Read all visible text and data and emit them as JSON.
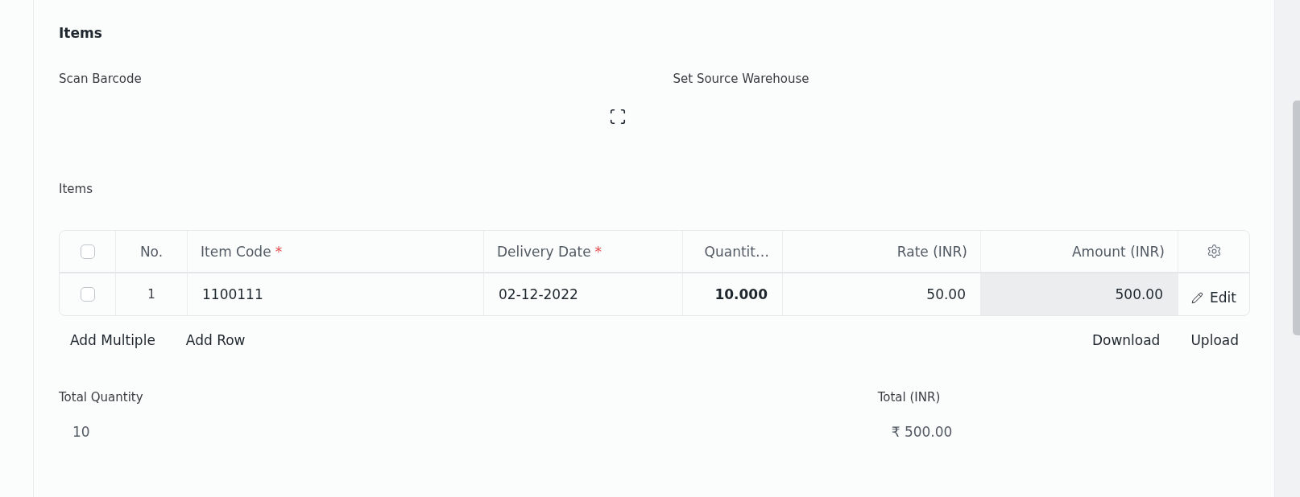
{
  "section": {
    "title": "Items"
  },
  "fields": [
    {
      "label": "Scan Barcode",
      "kind": "scan"
    },
    {
      "label": "Set Source Warehouse",
      "kind": "plain"
    }
  ],
  "table_label": "Items",
  "table": {
    "select_all": {
      "checked": false
    },
    "columns": [
      {
        "label": "No.",
        "kind": "index"
      },
      {
        "label": "Item Code",
        "mark": "*",
        "kind": "text"
      },
      {
        "label": "Delivery Date",
        "mark": "*",
        "kind": "text"
      },
      {
        "label": "Quantit…",
        "kind": "number",
        "bold": true
      },
      {
        "label": "Rate (INR)",
        "kind": "number"
      },
      {
        "label": "Amount (INR)",
        "kind": "number",
        "read_only": true
      }
    ],
    "rows": [
      {
        "selected": false,
        "cells": [
          "1",
          "1100111",
          "02-12-2022",
          "10.000",
          "50.00",
          "500.00"
        ],
        "action": "Edit"
      }
    ]
  },
  "grid_buttons": {
    "left": [
      "Add Multiple",
      "Add Row"
    ],
    "right": [
      "Download",
      "Upload"
    ]
  },
  "totals": [
    {
      "label": "Total Quantity",
      "value": "10"
    },
    {
      "label": "Total (INR)",
      "value": "₹ 500.00"
    }
  ]
}
